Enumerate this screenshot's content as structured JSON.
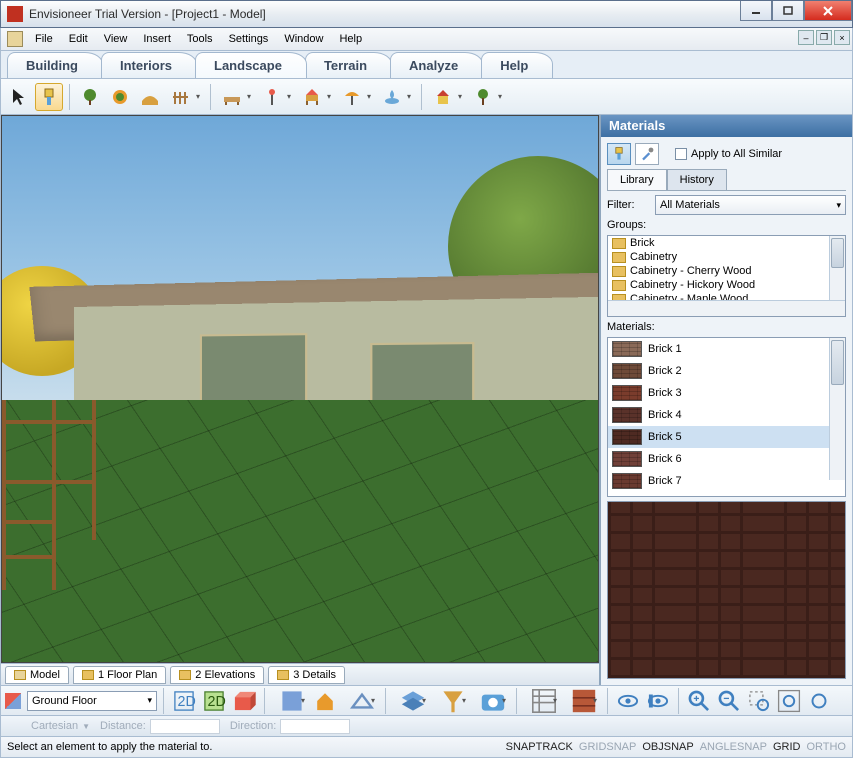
{
  "title": "Envisioneer Trial Version - [Project1 - Model]",
  "menus": [
    "File",
    "Edit",
    "View",
    "Insert",
    "Tools",
    "Settings",
    "Window",
    "Help"
  ],
  "modeTabs": [
    "Building",
    "Interiors",
    "Landscape",
    "Terrain",
    "Analyze",
    "Help"
  ],
  "activeModeTab": 2,
  "viewTabs": [
    {
      "label": "Model",
      "active": true
    },
    {
      "label": "1 Floor Plan"
    },
    {
      "label": "2 Elevations"
    },
    {
      "label": "3 Details"
    }
  ],
  "panel": {
    "title": "Materials",
    "applyAll": "Apply to All Similar",
    "tabs": [
      "Library",
      "History"
    ],
    "filterLabel": "Filter:",
    "filterValue": "All Materials",
    "groupsLabel": "Groups:",
    "groups": [
      "Brick",
      "Cabinetry",
      "Cabinetry - Cherry Wood",
      "Cabinetry - Hickory Wood",
      "Cabinetry - Maple Wood"
    ],
    "materialsLabel": "Materials:",
    "materials": [
      {
        "name": "Brick 1",
        "color": "#8a6a58"
      },
      {
        "name": "Brick 2",
        "color": "#6e4a38"
      },
      {
        "name": "Brick 3",
        "color": "#7a3c2c"
      },
      {
        "name": "Brick 4",
        "color": "#5a322a"
      },
      {
        "name": "Brick 5",
        "color": "#4e2a22",
        "selected": true
      },
      {
        "name": "Brick 6",
        "color": "#704038"
      },
      {
        "name": "Brick 7",
        "color": "#6a3a30"
      }
    ]
  },
  "bottom": {
    "floor": "Ground Floor"
  },
  "coords": {
    "mode": "Cartesian",
    "distance": "Distance:",
    "direction": "Direction:"
  },
  "status": "Select an element to apply the material to.",
  "snaps": [
    {
      "label": "SNAPTRACK",
      "on": true
    },
    {
      "label": "GRIDSNAP",
      "on": false
    },
    {
      "label": "OBJSNAP",
      "on": true
    },
    {
      "label": "ANGLESNAP",
      "on": false
    },
    {
      "label": "GRID",
      "on": true
    },
    {
      "label": "ORTHO",
      "on": false
    }
  ]
}
